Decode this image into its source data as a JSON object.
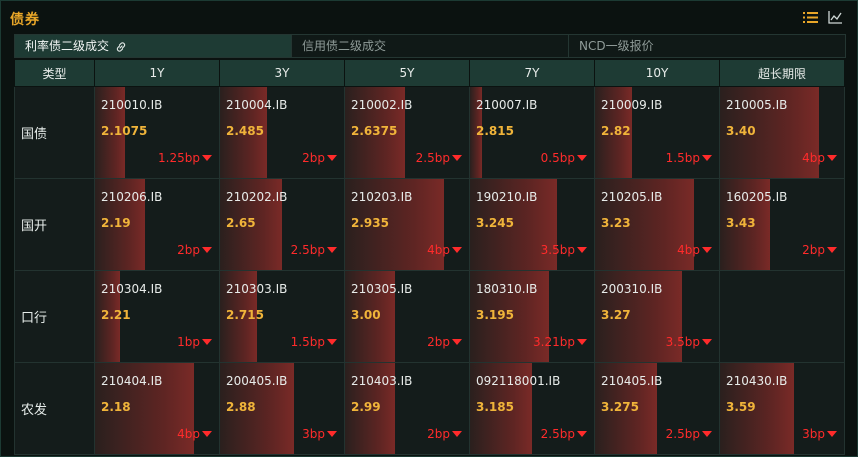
{
  "header": {
    "title": "债券"
  },
  "tabs": [
    {
      "label": "利率债二级成交",
      "active": true
    },
    {
      "label": "信用债二级成交",
      "active": false
    },
    {
      "label": "NCD一级报价",
      "active": false
    }
  ],
  "table": {
    "type_header": "类型",
    "columns": [
      "1Y",
      "3Y",
      "5Y",
      "7Y",
      "10Y",
      "超长期限"
    ],
    "rows": [
      {
        "type": "国债",
        "cells": [
          {
            "code": "210010.IB",
            "price": "2.1075",
            "change": "1.25bp",
            "direction": "down",
            "level": 0.24
          },
          {
            "code": "210004.IB",
            "price": "2.485",
            "change": "2bp",
            "direction": "down",
            "level": 0.38
          },
          {
            "code": "210002.IB",
            "price": "2.6375",
            "change": "2.5bp",
            "direction": "down",
            "level": 0.48
          },
          {
            "code": "210007.IB",
            "price": "2.815",
            "change": "0.5bp",
            "direction": "down",
            "level": 0.1
          },
          {
            "code": "210009.IB",
            "price": "2.82",
            "change": "1.5bp",
            "direction": "down",
            "level": 0.3
          },
          {
            "code": "210005.IB",
            "price": "3.40",
            "change": "4bp",
            "direction": "down",
            "level": 0.8
          }
        ]
      },
      {
        "type": "国开",
        "cells": [
          {
            "code": "210206.IB",
            "price": "2.19",
            "change": "2bp",
            "direction": "down",
            "level": 0.4
          },
          {
            "code": "210202.IB",
            "price": "2.65",
            "change": "2.5bp",
            "direction": "down",
            "level": 0.5
          },
          {
            "code": "210203.IB",
            "price": "2.935",
            "change": "4bp",
            "direction": "down",
            "level": 0.8
          },
          {
            "code": "190210.IB",
            "price": "3.245",
            "change": "3.5bp",
            "direction": "down",
            "level": 0.7
          },
          {
            "code": "210205.IB",
            "price": "3.23",
            "change": "4bp",
            "direction": "down",
            "level": 0.8
          },
          {
            "code": "160205.IB",
            "price": "3.43",
            "change": "2bp",
            "direction": "down",
            "level": 0.4
          }
        ]
      },
      {
        "type": "口行",
        "cells": [
          {
            "code": "210304.IB",
            "price": "2.21",
            "change": "1bp",
            "direction": "down",
            "level": 0.2
          },
          {
            "code": "210303.IB",
            "price": "2.715",
            "change": "1.5bp",
            "direction": "down",
            "level": 0.3
          },
          {
            "code": "210305.IB",
            "price": "3.00",
            "change": "2bp",
            "direction": "down",
            "level": 0.4
          },
          {
            "code": "180310.IB",
            "price": "3.195",
            "change": "3.21bp",
            "direction": "down",
            "level": 0.64
          },
          {
            "code": "200310.IB",
            "price": "3.27",
            "change": "3.5bp",
            "direction": "down",
            "level": 0.7
          },
          null
        ]
      },
      {
        "type": "农发",
        "cells": [
          {
            "code": "210404.IB",
            "price": "2.18",
            "change": "4bp",
            "direction": "down",
            "level": 0.8
          },
          {
            "code": "200405.IB",
            "price": "2.88",
            "change": "3bp",
            "direction": "down",
            "level": 0.6
          },
          {
            "code": "210403.IB",
            "price": "2.99",
            "change": "2bp",
            "direction": "down",
            "level": 0.4
          },
          {
            "code": "092118001.IB",
            "price": "3.185",
            "change": "2.5bp",
            "direction": "down",
            "level": 0.5
          },
          {
            "code": "210405.IB",
            "price": "3.275",
            "change": "2.5bp",
            "direction": "down",
            "level": 0.5
          },
          {
            "code": "210430.IB",
            "price": "3.59",
            "change": "3bp",
            "direction": "down",
            "level": 0.6
          }
        ]
      }
    ]
  },
  "colors": {
    "title": "#e8a628",
    "price": "#f0b43a",
    "down": "#ff2b2b",
    "header_bg": "#1e3b34"
  },
  "icons": [
    "list-icon",
    "line-chart-icon",
    "link-icon",
    "down-triangle-icon"
  ]
}
